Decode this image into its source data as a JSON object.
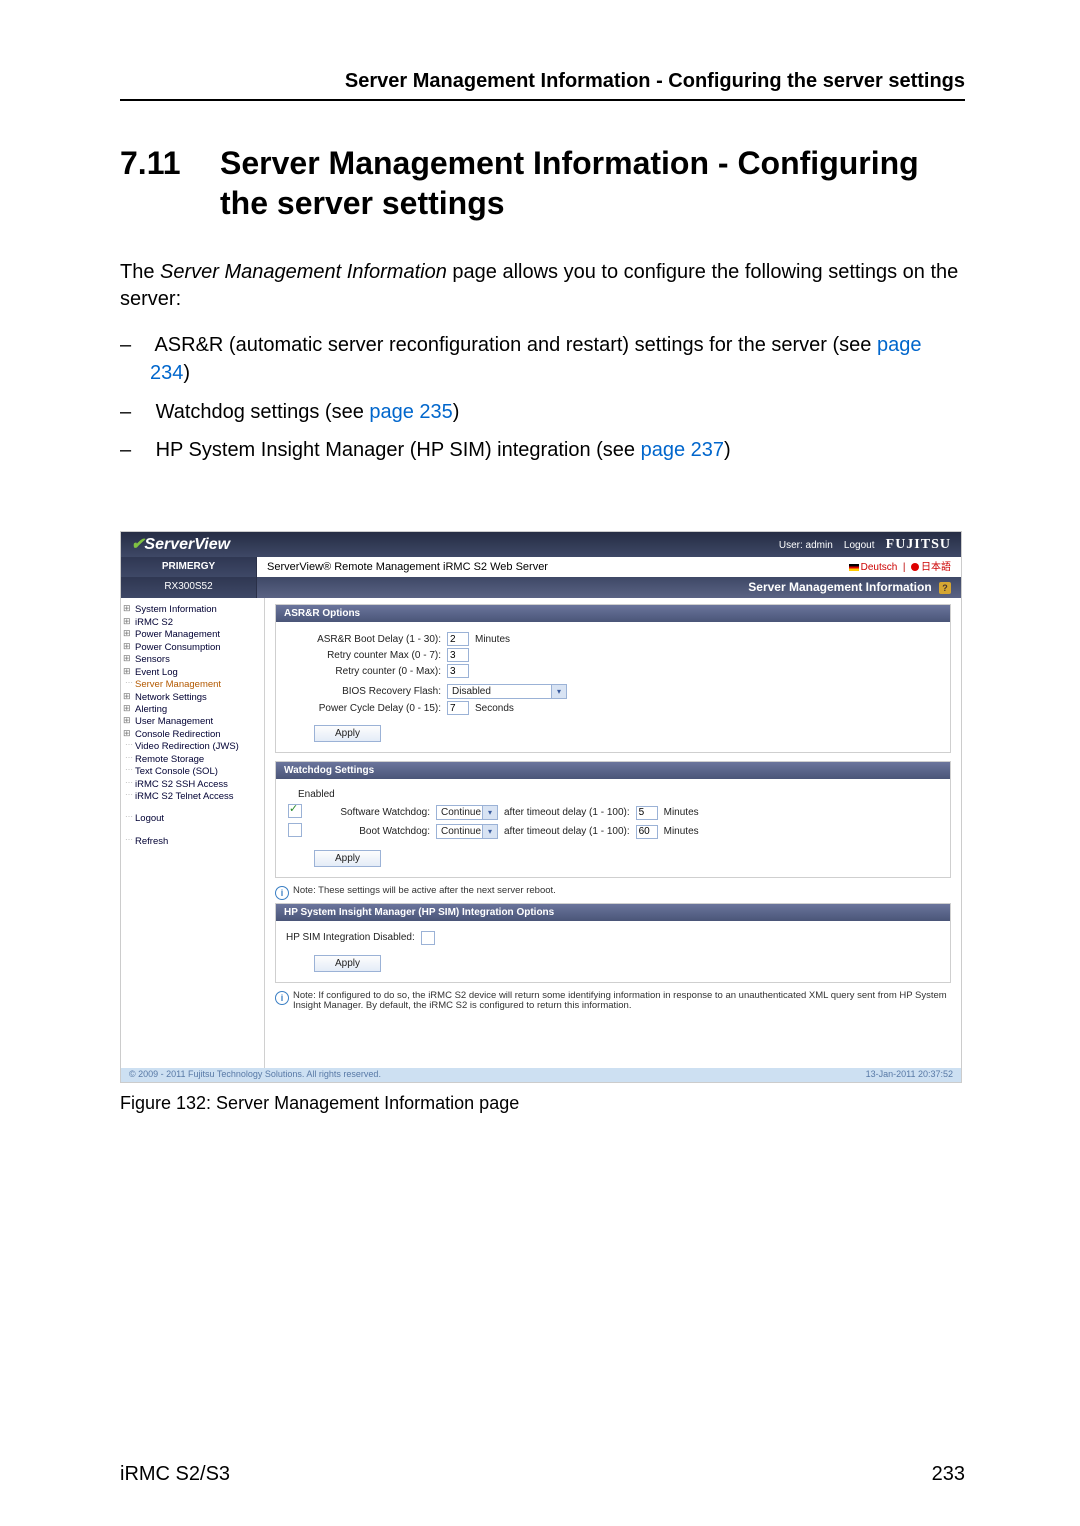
{
  "running_head": "Server Management Information - Configuring the server settings",
  "section": {
    "number": "7.11",
    "title": "Server Management Information - Configuring the server settings"
  },
  "intro_pre": "The ",
  "intro_em": "Server Management Information",
  "intro_post": " page allows you to configure the following settings on the server:",
  "bullets": [
    {
      "text_pre": "ASR&R (automatic server reconfiguration and restart) settings for the server (see ",
      "link": "page 234",
      "text_post": ")"
    },
    {
      "text_pre": "Watchdog settings (see ",
      "link": "page 235",
      "text_post": ")"
    },
    {
      "text_pre": "HP System Insight Manager (HP SIM) integration (see ",
      "link": "page 237",
      "text_post": ")"
    }
  ],
  "screenshot": {
    "brand": "ServerView",
    "user_label": "User: admin",
    "logout": "Logout",
    "vendor_logo": "FUJITSU",
    "primergy": "PRIMERGY",
    "subtitle": "ServerView® Remote Management iRMC S2 Web Server",
    "lang_de": "Deutsch",
    "lang_jp": "日本語",
    "host": "RX300S52",
    "panel_title": "Server Management Information",
    "nav": [
      "System Information",
      "iRMC S2",
      "Power Management",
      "Power Consumption",
      "Sensors",
      "Event Log",
      "Server Management",
      "Network Settings",
      "Alerting",
      "User Management",
      "Console Redirection",
      "Video Redirection (JWS)",
      "Remote Storage",
      "Text Console (SOL)",
      "iRMC S2 SSH Access",
      "iRMC S2 Telnet Access",
      "Logout",
      "Refresh"
    ],
    "asr": {
      "title": "ASR&R Options",
      "boot_delay_label": "ASR&R Boot Delay (1 - 30):",
      "boot_delay_value": "2",
      "boot_delay_unit": "Minutes",
      "retry_max_label": "Retry counter Max (0 - 7):",
      "retry_max_value": "3",
      "retry_cur_label": "Retry counter (0 - Max):",
      "retry_cur_value": "3",
      "bios_flash_label": "BIOS Recovery Flash:",
      "bios_flash_value": "Disabled",
      "power_delay_label": "Power Cycle Delay (0 - 15):",
      "power_delay_value": "7",
      "power_delay_unit": "Seconds",
      "apply": "Apply"
    },
    "wd": {
      "title": "Watchdog Settings",
      "enabled_label": "Enabled",
      "sw_label": "Software Watchdog:",
      "sw_action": "Continue",
      "sw_delay_label": "after timeout delay (1 - 100):",
      "sw_delay_value": "5",
      "sw_unit": "Minutes",
      "boot_label": "Boot Watchdog:",
      "boot_action": "Continue",
      "boot_delay_label": "after timeout delay (1 - 100):",
      "boot_delay_value": "60",
      "boot_unit": "Minutes",
      "apply": "Apply",
      "note": "Note: These settings will be active after the next server reboot."
    },
    "hpsim": {
      "title": "HP System Insight Manager (HP SIM) Integration Options",
      "disabled_label": "HP SIM Integration Disabled:",
      "apply": "Apply",
      "note": "Note: If configured to do so, the iRMC S2 device will return some identifying information in response to an unauthenticated XML query sent from HP System Insight Manager. By default, the iRMC S2 is configured to return this information."
    },
    "copyright": "© 2009 - 2011 Fujitsu Technology Solutions. All rights reserved.",
    "datetime": "13-Jan-2011  20:37:52"
  },
  "figcaption": "Figure 132: Server Management Information page",
  "footer_left": "iRMC S2/S3",
  "footer_right": "233"
}
